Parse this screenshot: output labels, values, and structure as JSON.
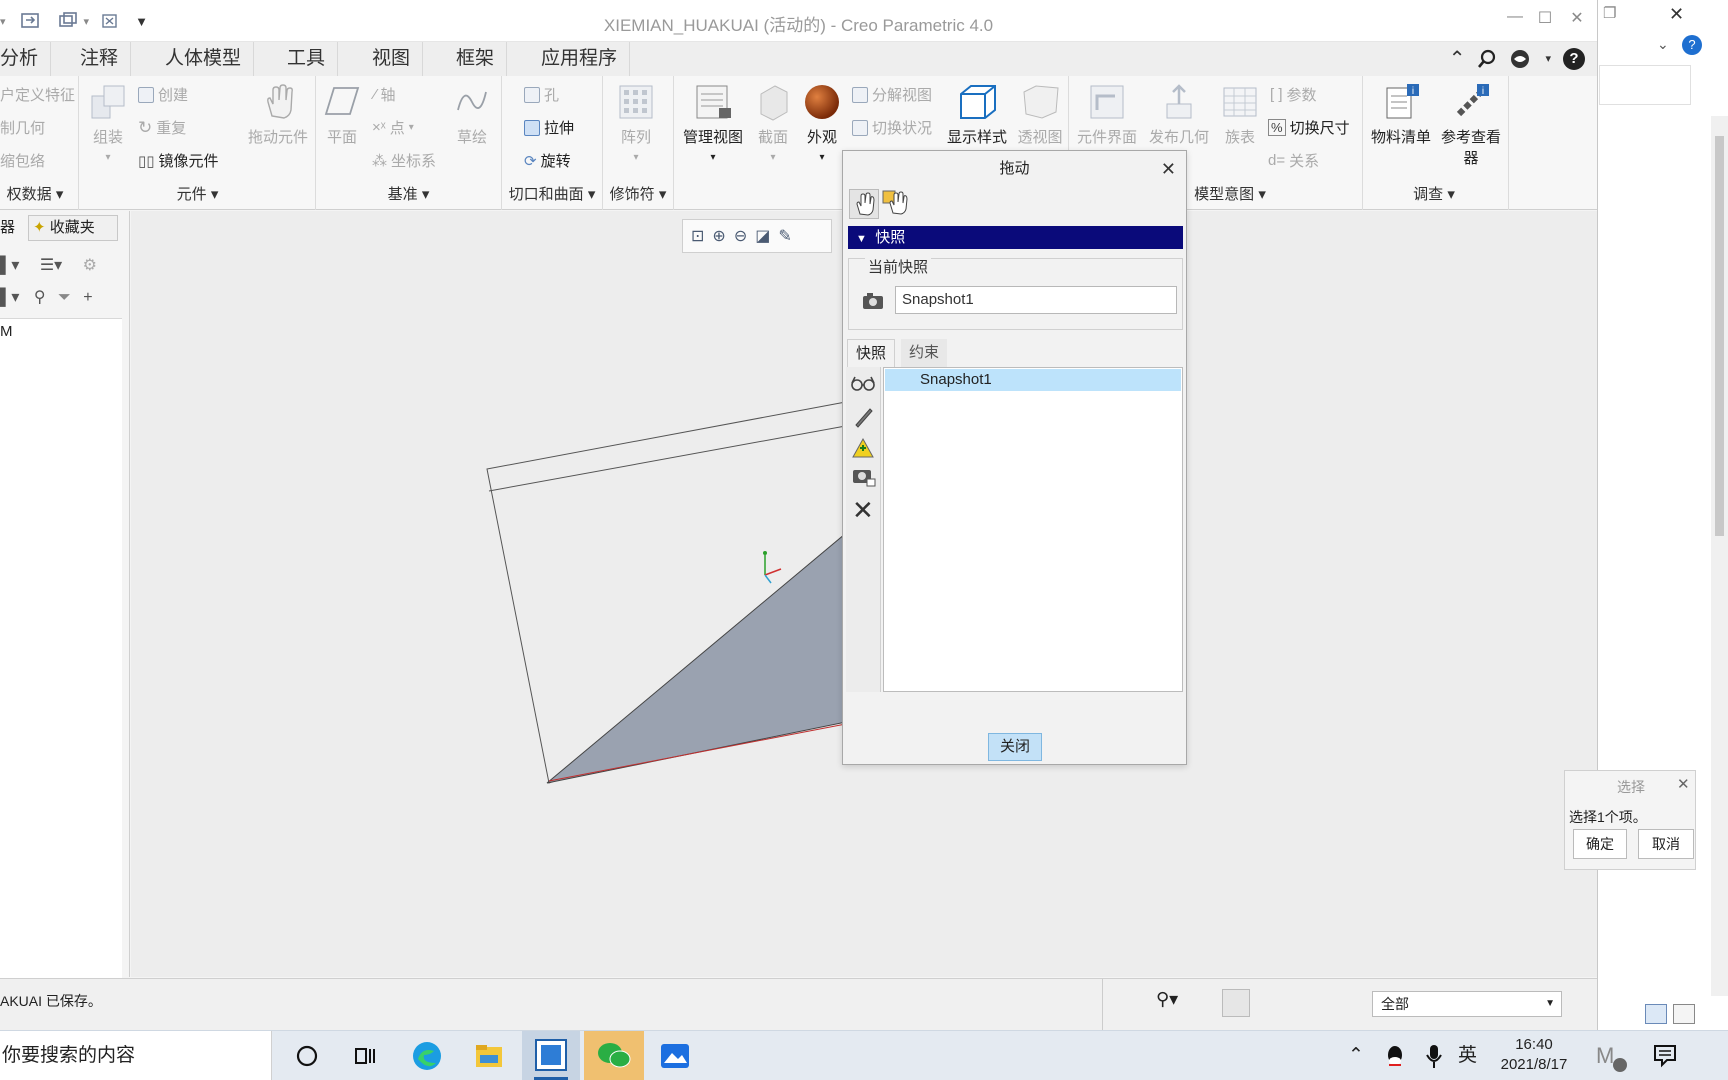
{
  "window": {
    "title": "XIEMIAN_HUAKUAI (活动的) - Creo Parametric 4.0"
  },
  "tabs": [
    "分析",
    "注释",
    "人体模型",
    "工具",
    "视图",
    "框架",
    "应用程序"
  ],
  "ribbon": {
    "groups": {
      "g0": "权数据",
      "g1": "元件",
      "g2": "基准",
      "g3": "切口和曲面",
      "g4": "修饰符",
      "g5": "模型意图",
      "g6": "调查"
    },
    "col0": [
      "户定义特征",
      "制几何",
      "缩包络"
    ],
    "assemble": "组装",
    "create": "创建",
    "repeat": "重复",
    "mirror_component": "镜像元件",
    "drag_component": "拖动元件",
    "plane": "平面",
    "axis": "轴",
    "point": "点",
    "coord_sys": "坐标系",
    "sketch": "草绘",
    "hole": "孔",
    "extrude": "拉伸",
    "revolve": "旋转",
    "pattern": "阵列",
    "manage_views": "管理视图",
    "section": "截面",
    "appearance": "外观",
    "explode_view": "分解视图",
    "toggle_status": "切换状况",
    "display_style": "显示样式",
    "perspective": "透视图",
    "comp_interface": "元件界面",
    "publish_geom": "发布几何",
    "family_table": "族表",
    "params": "参数",
    "switch_dims": "切换尺寸",
    "relations": "关系",
    "bom": "物料清单",
    "ref_viewer": "参考查看器"
  },
  "left_panel": {
    "tab1": "器",
    "tab2": "收藏夹",
    "tree_item": "M"
  },
  "status": {
    "message": "AKUAI 已保存。",
    "filter_value": "全部"
  },
  "drag_dialog": {
    "title": "拖动",
    "section": "快照",
    "current_snapshot_label": "当前快照",
    "snapshot_name": "Snapshot1",
    "tabs": [
      "快照",
      "约束"
    ],
    "list": [
      "Snapshot1"
    ],
    "close_button": "关闭"
  },
  "select_dialog": {
    "title": "选择",
    "message": "选择1个项。",
    "ok": "确定",
    "cancel": "取消"
  },
  "taskbar": {
    "search_text": "你要搜索的内容",
    "ime": "英",
    "time": "16:40",
    "date": "2021/8/17"
  },
  "colors": {
    "section_header": "#0a0a7a",
    "list_selection": "#bde3fb",
    "close_button": "#c3e1f7",
    "part_face": "#9aa2b0"
  }
}
